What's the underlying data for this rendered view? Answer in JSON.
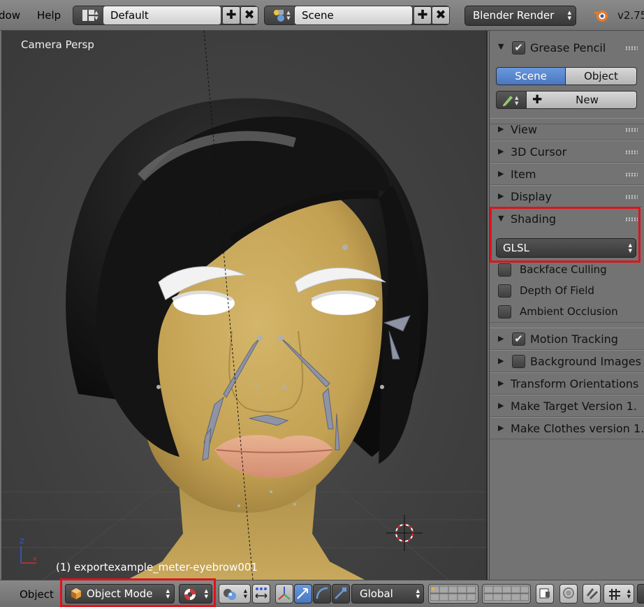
{
  "header": {
    "menu_window": "dow",
    "menu_help": "Help",
    "layout_name": "Default",
    "scene_name": "Scene",
    "render_engine": "Blender Render",
    "version": "v2.75"
  },
  "viewport": {
    "view_label": "Camera Persp",
    "object_label": "(1) exportexample_meter-eyebrow001"
  },
  "panel": {
    "grease_pencil": {
      "title": "Grease Pencil",
      "checked": true,
      "tab_scene": "Scene",
      "tab_object": "Object",
      "new_label": "New"
    },
    "sections": {
      "view": "View",
      "cursor": "3D Cursor",
      "item": "Item",
      "display": "Display",
      "shading": "Shading",
      "motion_tracking": "Motion Tracking",
      "background_images": "Background Images",
      "transform_orientations": "Transform Orientations",
      "make_target": "Make Target  Version 1.",
      "make_clothes": "Make Clothes version 1."
    },
    "shading": {
      "mode": "GLSL",
      "backface_culling": "Backface Culling",
      "depth_of_field": "Depth Of Field",
      "ambient_occlusion": "Ambient Occlusion"
    }
  },
  "bottom": {
    "menu_object": "Object",
    "mode": "Object Mode",
    "orientation": "Global"
  },
  "colors": {
    "highlight_red": "#e0121b",
    "accent_blue": "#5680c2",
    "skin": "#c9a85a"
  }
}
